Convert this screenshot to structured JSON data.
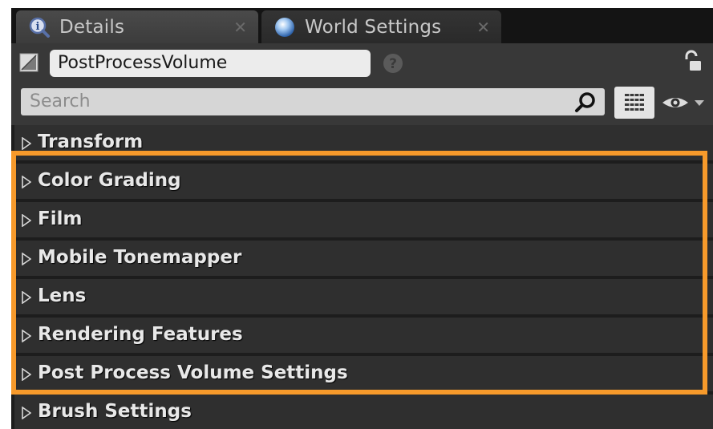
{
  "tabs": [
    {
      "label": "Details",
      "icon": "details-info-icon",
      "active": true
    },
    {
      "label": "World Settings",
      "icon": "world-globe-icon",
      "active": false
    }
  ],
  "name_row": {
    "actor_name": "PostProcessVolume"
  },
  "search": {
    "placeholder": "Search"
  },
  "categories": [
    {
      "label": "Transform"
    },
    {
      "label": "Color Grading"
    },
    {
      "label": "Film"
    },
    {
      "label": "Mobile Tonemapper"
    },
    {
      "label": "Lens"
    },
    {
      "label": "Rendering Features"
    },
    {
      "label": "Post Process Volume Settings"
    },
    {
      "label": "Brush Settings"
    }
  ],
  "colors": {
    "highlight": "#f79a2b",
    "panel_bg": "#1d1d1d",
    "category_bg": "#2f2f2f"
  }
}
